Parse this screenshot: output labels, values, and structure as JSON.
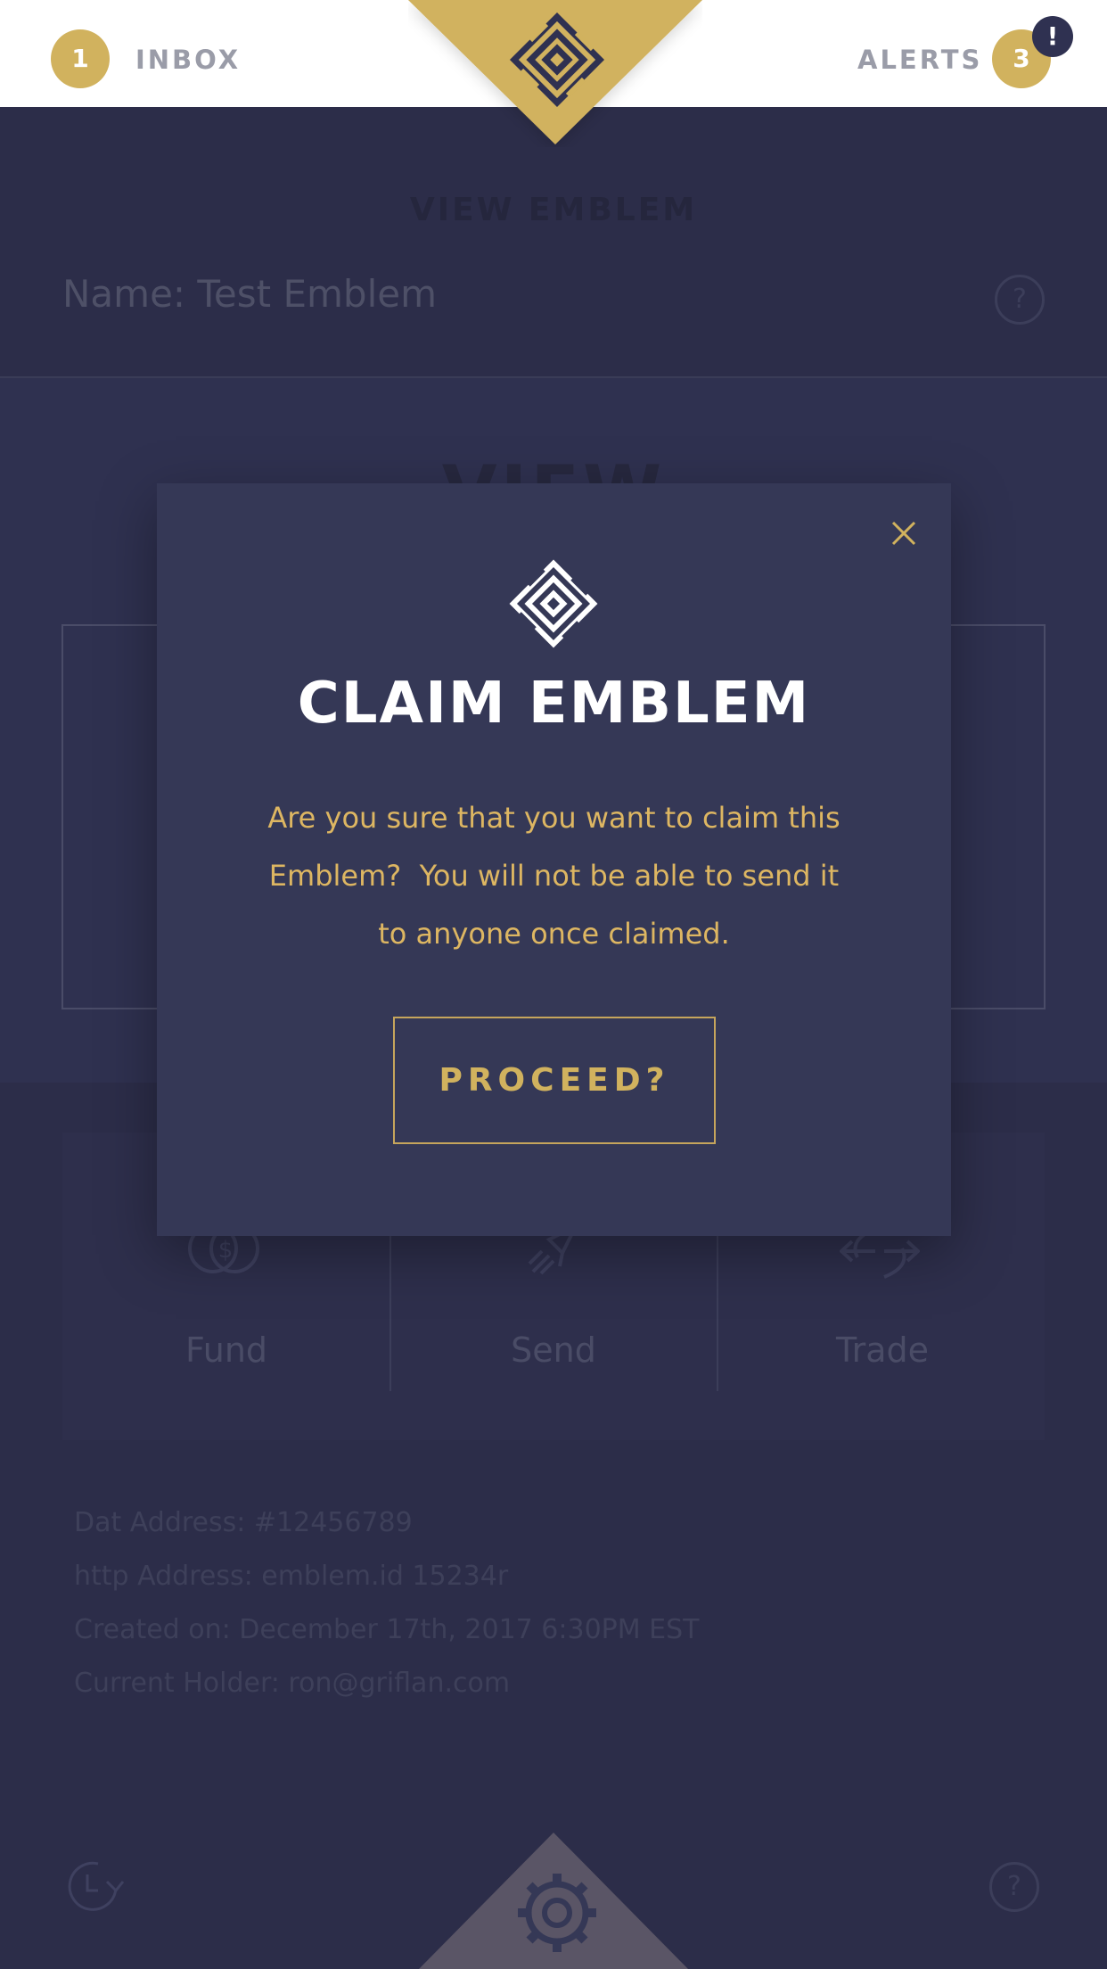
{
  "header": {
    "inbox_count": "1",
    "inbox_label": "INBOX",
    "alerts_label": "ALERTS",
    "alerts_count": "3",
    "alert_badge": "!"
  },
  "page": {
    "section_title": "VIEW EMBLEM",
    "name_line": "Name: Test Emblem",
    "help_symbol": "?",
    "view_heading": "VIEW"
  },
  "actions": [
    {
      "label": "Fund",
      "icon": "fund-coins-icon"
    },
    {
      "label": "Send",
      "icon": "send-rocket-icon"
    },
    {
      "label": "Trade",
      "icon": "trade-arrows-icon"
    }
  ],
  "info": {
    "dat_address": "Dat Address: #12456789",
    "http_address": "http Address: emblem.id 15234r",
    "created_on": "Created on: December 17th, 2017 6:30PM EST",
    "current_holder": "Current Holder: ron@griflan.com"
  },
  "modal": {
    "title": "CLAIM EMBLEM",
    "message_line1": "Are you sure that you want to claim this",
    "message_line2": "Emblem?  You will not be able to send it",
    "message_line3": "to anyone once claimed.",
    "proceed_label": "PROCEED?"
  },
  "colors": {
    "gold": "#d1b25e",
    "navy": "#2c2d49",
    "modal_bg": "#353856",
    "white": "#ffffff"
  }
}
